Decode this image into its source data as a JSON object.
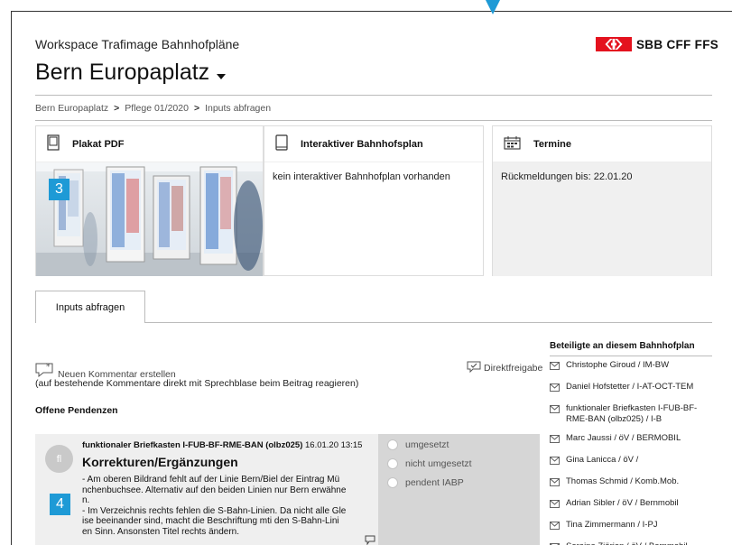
{
  "header": {
    "app_title": "Workspace Trafimage Bahnhofpläne",
    "page_title": "Bern Europaplatz",
    "logo_text": "SBB CFF FFS",
    "logo_color": "#e4121e"
  },
  "breadcrumb": [
    "Bern Europaplatz",
    "Pflege 01/2020",
    "Inputs abfragen"
  ],
  "breadcrumb_separator": ">",
  "cards": {
    "plakat": {
      "title": "Plakat PDF",
      "badge": "3"
    },
    "interaktiv": {
      "title": "Interaktiver Bahnhofsplan",
      "text": "kein interaktiver Bahnhofplan vorhanden"
    },
    "termine": {
      "title": "Termine",
      "text": "Rückmeldungen bis: 22.01.20"
    }
  },
  "tabs": [
    {
      "label": "Inputs abfragen"
    }
  ],
  "actions": {
    "new_comment": "Neuen Kommentar erstellen",
    "hint": "(auf bestehende Kommentare direkt mit Sprechblase beim Beitrag reagieren)",
    "direct_release": "Direktfreigabe"
  },
  "pending": {
    "heading": "Offene Pendenzen",
    "item": {
      "avatar": "fl",
      "author": "funktionaler Briefkasten I-FUB-BF-RME-BAN (olbz025)",
      "date": "16.01.20 13:15",
      "title": "Korrekturen/Ergänzungen",
      "badge": "4",
      "lines": [
        "- Am oberen Bildrand fehlt auf der Linie Bern/Biel der Eintrag Mü",
        "nchenbuchsee. Alternativ auf den beiden Linien nur Bern erwähne",
        "n.",
        "- Im Verzeichnis rechts fehlen die S-Bahn-Linien. Da nicht alle Gle",
        "ise beeinander sind, macht die Beschriftung mti den S-Bahn-Lini",
        "en Sinn. Ansonsten Titel rechts ändern."
      ],
      "status_options": [
        "umgesetzt",
        "nicht umgesetzt",
        "pendent IABP"
      ]
    }
  },
  "participants": {
    "heading": "Beteiligte an diesem Bahnhofplan",
    "items": [
      "Christophe Giroud / IM-BW",
      "Daniel Hofstetter / I-AT-OCT-TEM",
      "funktionaler Briefkasten I-FUB-BF-RME-BAN (olbz025) / I-B",
      "Marc Jaussi / öV / BERMOBIL",
      "Gina Lanicca / öV /",
      "Thomas Schmid / Komb.Mob.",
      "Adrian Sibler / öV / Bernmobil",
      "Tina Zimmermann / I-PJ",
      "Seraina Ziörjen / öV / Bernmobil"
    ]
  },
  "colors": {
    "accent": "#1e9ad6",
    "sbb_red": "#e4121e"
  }
}
